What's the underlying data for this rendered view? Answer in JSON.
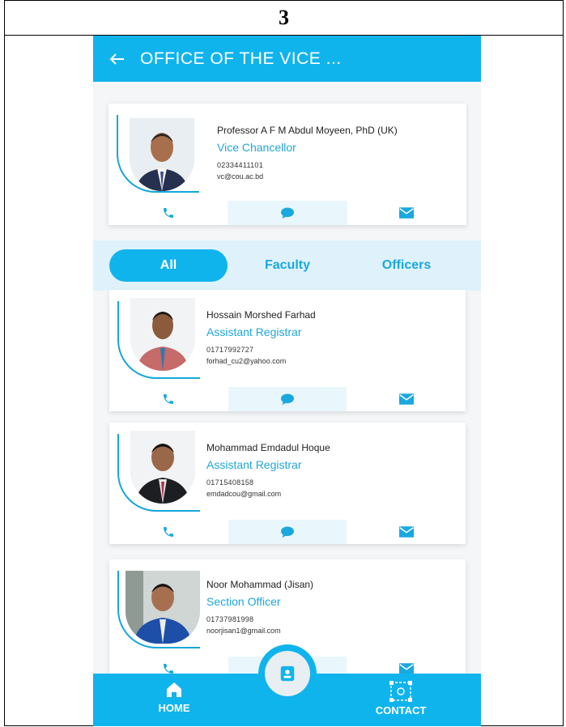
{
  "document": {
    "label": "3"
  },
  "appbar": {
    "title": "OFFICE OF THE VICE ..."
  },
  "head": {
    "name": "Professor A F M Abdul Moyeen, PhD (UK)",
    "role": "Vice Chancellor",
    "phone": "02334411101",
    "email": "vc@cou.ac.bd"
  },
  "tabs": [
    {
      "label": "All"
    },
    {
      "label": "Faculty"
    },
    {
      "label": "Officers"
    }
  ],
  "people": [
    {
      "name": "Hossain Morshed Farhad",
      "role": "Assistant Registrar",
      "phone": "01717992727",
      "email": "forhad_cu2@yahoo.com"
    },
    {
      "name": "Mohammad Emdadul Hoque",
      "role": "Assistant Registrar",
      "phone": "01715408158",
      "email": "emdadcou@gmail.com"
    },
    {
      "name": "Noor Mohammad (Jisan)",
      "role": "Section Officer",
      "phone": "01737981998",
      "email": "noorjisan1@gmail.com"
    }
  ],
  "bottom_nav": {
    "home": "HOME",
    "contact": "CONTACT"
  },
  "colors": {
    "primary": "#10b4ec",
    "accent_text": "#20a6da",
    "tab_bg": "#dff2fb"
  }
}
